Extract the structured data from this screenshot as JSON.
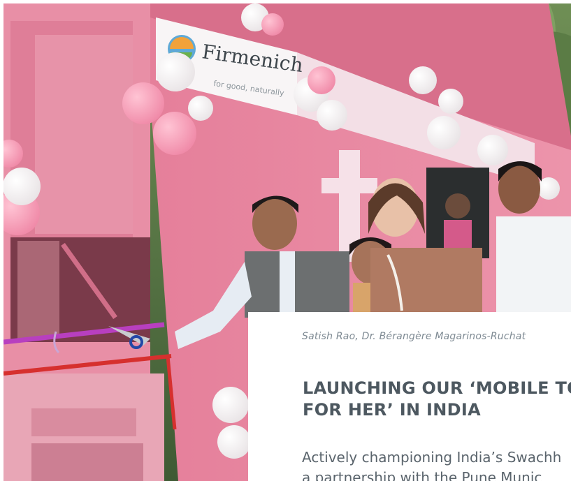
{
  "photo": {
    "description_icon": "photo-ribbon-cutting",
    "sponsor": {
      "brand_name": "Firmenich",
      "tagline": "for good, naturally"
    }
  },
  "card": {
    "caption": "Satish Rao, Dr. Bérangère Magarinos-Ruchat",
    "headline_line1": "LAUNCHING OUR ‘MOBILE TO",
    "headline_line2": "FOR HER’ IN INDIA",
    "body_line1": "Actively championing India’s Swachh",
    "body_line2": "a partnership with the Pune Munic"
  },
  "colors": {
    "pink_van": "#e98aa3",
    "heading": "#4d5860",
    "caption": "#7e8a93"
  }
}
